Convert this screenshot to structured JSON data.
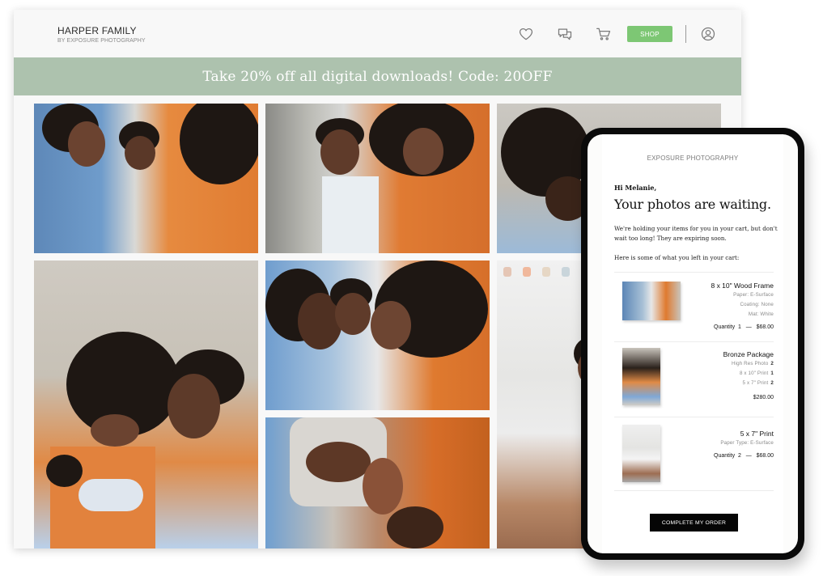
{
  "gallery": {
    "title": "HARPER FAMILY",
    "subtitle": "BY EXPOSURE PHOTOGRAPHY",
    "nav": {
      "icons": [
        "heart-icon",
        "chat-icon",
        "cart-icon",
        "user-icon"
      ],
      "shop_label": "SHOP"
    },
    "promo_text": "Take 20% off all digital downloads! Code: 20OFF",
    "colors": {
      "promo_bg": "#adc2ae",
      "shop_button": "#7dc774"
    }
  },
  "email": {
    "brand": "EXPOSURE PHOTOGRAPHY",
    "greeting": "Hi Melanie,",
    "headline": "Your photos are waiting.",
    "body": "We're holding your items for you in your cart, but don't wait too long!  They are expiring soon.",
    "cart_intro": "Here is some of what you left in your cart:",
    "items": [
      {
        "name": "8 x 10\" Wood Frame",
        "details": [
          {
            "label": "Paper:",
            "value": "E-Surface"
          },
          {
            "label": "Coating:",
            "value": "None"
          },
          {
            "label": "Mat:",
            "value": "White"
          }
        ],
        "quantity_label": "Quantity",
        "quantity": "1",
        "separator": "—",
        "price": "$68.00"
      },
      {
        "name": "Bronze Package",
        "details": [
          {
            "label": "High Res Photo",
            "value": "2"
          },
          {
            "label": "8 x 10\" Print",
            "value": "1"
          },
          {
            "label": "5 x 7\" Print",
            "value": "2"
          }
        ],
        "price": "$280.00"
      },
      {
        "name": "5 x 7\" Print",
        "details": [
          {
            "label": "Paper Type:",
            "value": "E-Surface"
          }
        ],
        "quantity_label": "Quantity",
        "quantity": "2",
        "separator": "—",
        "price": "$68.00"
      }
    ],
    "cta_label": "COMPLETE MY ORDER"
  }
}
